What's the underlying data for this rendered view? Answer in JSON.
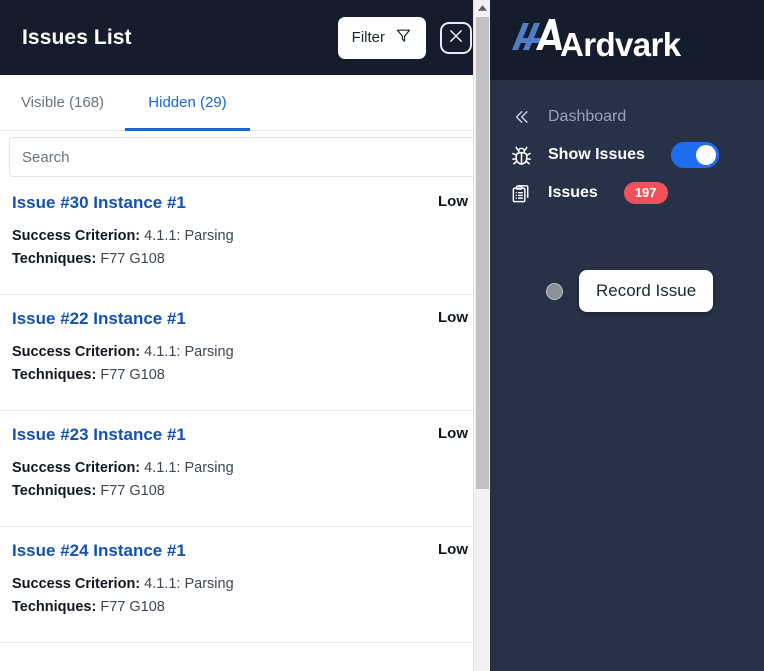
{
  "panel": {
    "title": "Issues List",
    "filter_label": "Filter",
    "filter_icon": "funnel-icon",
    "close_icon": "close-x-icon",
    "tabs": [
      {
        "label": "Visible (168)",
        "active": false
      },
      {
        "label": "Hidden (29)",
        "active": true
      }
    ],
    "search": {
      "placeholder": "Search",
      "value": ""
    },
    "issues": [
      {
        "title": "Issue #30 Instance #1",
        "severity": "Low",
        "criterion_label": "Success Criterion:",
        "criterion_value": "4.1.1: Parsing",
        "techniques_label": "Techniques:",
        "techniques_value": "F77 G108"
      },
      {
        "title": "Issue #22 Instance #1",
        "severity": "Low",
        "criterion_label": "Success Criterion:",
        "criterion_value": "4.1.1: Parsing",
        "techniques_label": "Techniques:",
        "techniques_value": "F77 G108"
      },
      {
        "title": "Issue #23 Instance #1",
        "severity": "Low",
        "criterion_label": "Success Criterion:",
        "criterion_value": "4.1.1: Parsing",
        "techniques_label": "Techniques:",
        "techniques_value": "F77 G108"
      },
      {
        "title": "Issue #24 Instance #1",
        "severity": "Low",
        "criterion_label": "Success Criterion:",
        "criterion_value": "4.1.1: Parsing",
        "techniques_label": "Techniques:",
        "techniques_value": "F77 G108"
      }
    ],
    "scrollbar": {
      "up_arrow_icon": "scroll-up-arrow-icon"
    }
  },
  "sidebar": {
    "logo_text": "Ardvark",
    "logo_mark_icon": "aa-monogram-icon",
    "nav": [
      {
        "label": "Dashboard",
        "icon": "chevron-double-left-icon",
        "control": "none"
      },
      {
        "label": "Show Issues",
        "icon": "bug-icon",
        "control": "toggle",
        "toggle_on": true
      },
      {
        "label": "Issues",
        "icon": "clipboard-list-icon",
        "control": "badge",
        "badge": "197"
      }
    ],
    "record": {
      "dot_icon": "record-dot-icon",
      "tooltip_label": "Record Issue"
    }
  },
  "colors": {
    "header_bg": "#151c2c",
    "sidebar_bg": "#273248",
    "accent_blue": "#1565d8",
    "link_blue": "#1352b0",
    "toggle_blue": "#1f6ef0",
    "badge_red": "#f1515a",
    "logo_blue": "#4f7ec4"
  }
}
